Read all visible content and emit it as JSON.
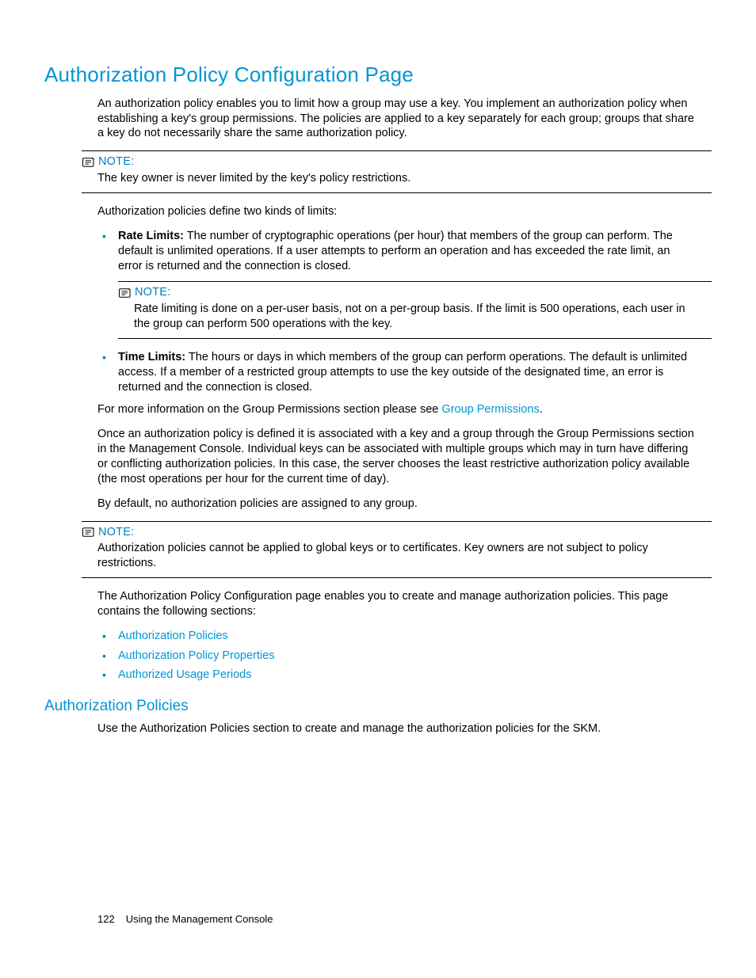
{
  "title": "Authorization Policy Configuration Page",
  "intro": "An authorization policy enables you to limit how a group may use a key. You implement an authorization policy when establishing a key's group permissions. The policies are applied to a key separately for each group; groups that share a key do not necessarily share the same authorization policy.",
  "note_label": "NOTE:",
  "note1": "The key owner is never limited by the key's policy restrictions.",
  "para_limits_intro": "Authorization policies define two kinds of limits:",
  "rate_limits_label": "Rate Limits:",
  "rate_limits_text": " The number of cryptographic operations (per hour) that members of the group can perform. The default is unlimited operations. If a user attempts to perform an operation and has exceeded the rate limit, an error is returned and the connection is closed.",
  "note2": "Rate limiting is done on a per-user basis, not on a per-group basis. If the limit is 500 operations, each user in the group can perform 500 operations with the key.",
  "time_limits_label": "Time Limits:",
  "time_limits_text": " The hours or days in which members of the group can perform operations. The default is unlimited access. If a member of a restricted group attempts to use the key outside of the designated time, an error is returned and the connection is closed.",
  "moreinfo_pre": "For more information on the Group Permissions section please see ",
  "moreinfo_link": "Group Permissions",
  "moreinfo_post": ".",
  "once_defined": "Once an authorization policy is defined it is associated with a key and a group through the Group Permissions section in the Management Console. Individual keys can be associated with multiple groups which may in turn have differing or conflicting authorization policies. In this case, the server chooses the least restrictive authorization policy available (the most operations per hour for the current time of day).",
  "by_default": "By default, no authorization policies are assigned to any group.",
  "note3": "Authorization policies cannot be applied to global keys or to certificates. Key owners are not subject to policy restrictions.",
  "page_enables": "The Authorization Policy Configuration page enables you to create and manage authorization policies. This page contains the following sections:",
  "sections": {
    "a": "Authorization Policies",
    "b": "Authorization Policy Properties",
    "c": "Authorized Usage Periods"
  },
  "subhead": "Authorization Policies",
  "subhead_text": "Use the Authorization Policies section to create and manage the authorization policies for the SKM.",
  "footer_page": "122",
  "footer_text": "Using the Management Console"
}
